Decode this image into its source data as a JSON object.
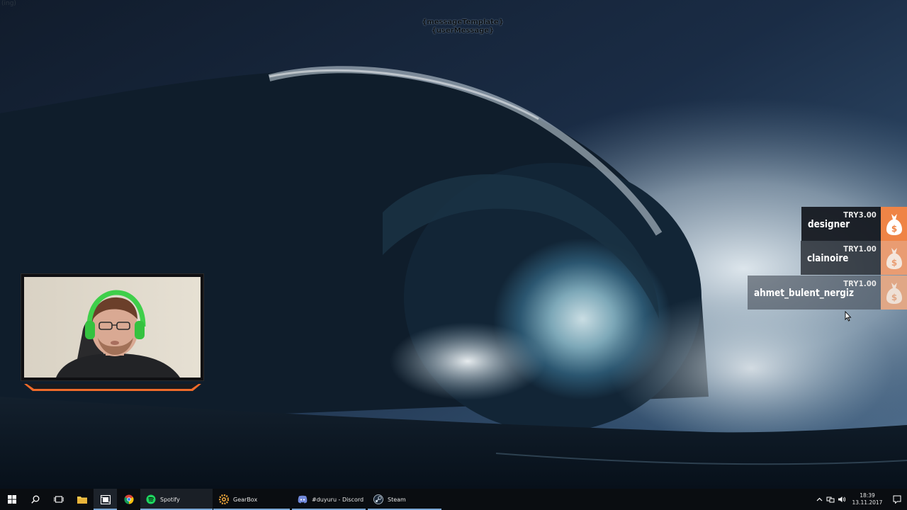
{
  "overlay": {
    "corner_label": "(ing)",
    "template_line_1": "{messageTemplate}",
    "template_line_2": "{userMessage}"
  },
  "donations": [
    {
      "name": "designer",
      "amount": "TRY3.00",
      "icon": "money-bag-icon"
    },
    {
      "name": "clainoire",
      "amount": "TRY1.00",
      "icon": "money-bag-icon"
    },
    {
      "name": "ahmet_bulent_nergiz",
      "amount": "TRY1.00",
      "icon": "money-bag-icon"
    }
  ],
  "taskbar": {
    "apps": [
      {
        "label": "Spotify",
        "icon": "spotify-icon"
      },
      {
        "label": "GearBox",
        "icon": "gearbox-icon"
      },
      {
        "label": "#duyuru - Discord",
        "icon": "discord-icon"
      },
      {
        "label": "Steam",
        "icon": "steam-icon"
      }
    ],
    "clock_time": "18:39",
    "clock_date": "13.11.2017"
  },
  "colors": {
    "accent_orange": "#ef8446",
    "taskbar_bg": "#0a0d11",
    "taskbar_underline": "#7aa6d4"
  }
}
